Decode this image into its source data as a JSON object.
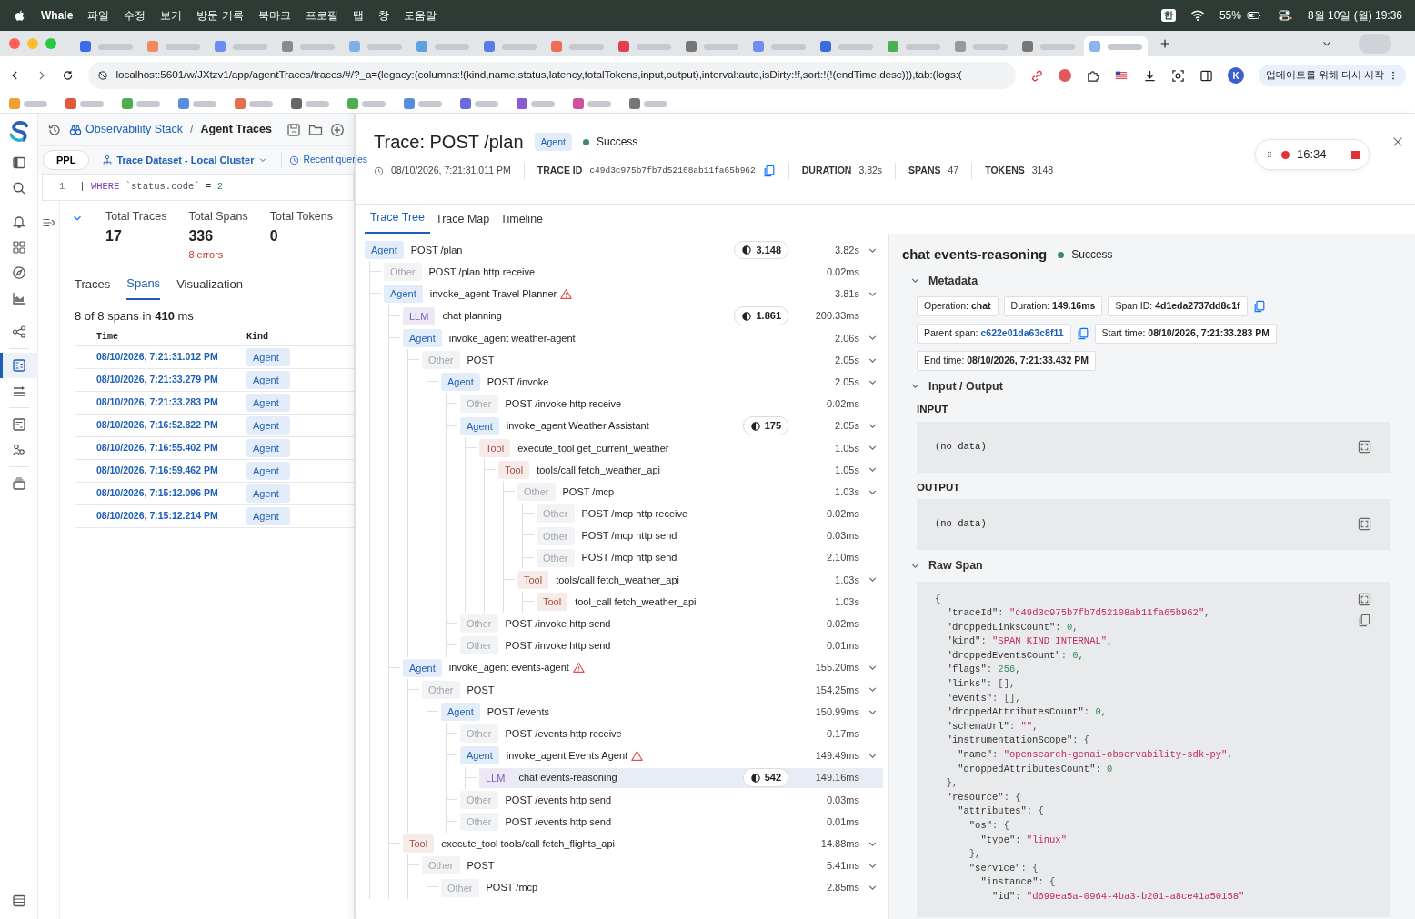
{
  "menubar": {
    "app": "Whale",
    "menus": [
      "파일",
      "수정",
      "보기",
      "방문 기록",
      "북마크",
      "프로필",
      "탭",
      "창",
      "도움말"
    ],
    "input_source": "한",
    "battery": "55%",
    "clock": "8월 10일 (월) 19:36"
  },
  "browser": {
    "tabs": [
      {
        "selected": false,
        "color": "#3a6ee8"
      },
      {
        "selected": false,
        "color": "#f08a5d"
      },
      {
        "selected": false,
        "color": "#6b8cf0"
      },
      {
        "selected": false,
        "color": "#8a8a8a"
      },
      {
        "selected": false,
        "color": "#7fb0e8"
      },
      {
        "selected": false,
        "color": "#5ea0e0"
      },
      {
        "selected": false,
        "color": "#5b7be8"
      },
      {
        "selected": false,
        "color": "#ef6c57"
      },
      {
        "selected": false,
        "color": "#e04050"
      },
      {
        "selected": false,
        "color": "#777777"
      },
      {
        "selected": false,
        "color": "#6f8ff0"
      },
      {
        "selected": false,
        "color": "#3d6ae0"
      },
      {
        "selected": false,
        "color": "#4caf50"
      },
      {
        "selected": false,
        "color": "#999999"
      },
      {
        "selected": false,
        "color": "#777777"
      },
      {
        "selected": true,
        "color": "#8cb4f0"
      }
    ],
    "url": "localhost:5601/w/JXtzv1/app/agentTraces/traces/#/?_a=(legacy:(columns:!(kind,name,status,latency,totalTokens,input,output),interval:auto,isDirty:!f,sort:!(!(endTime,desc))),tab:(logs:(",
    "profile": "K",
    "update_button": "업데이트를 위해 다시 시작",
    "bookmarks": [
      {
        "color": "#f0a030"
      },
      {
        "color": "#e05a3a"
      },
      {
        "color": "#4caf50"
      },
      {
        "color": "#5a8de0"
      },
      {
        "color": "#e07050"
      },
      {
        "color": "#666666"
      },
      {
        "color": "#4caf50"
      },
      {
        "color": "#5a8de0"
      },
      {
        "color": "#6a6ae0"
      },
      {
        "color": "#8a5ad0"
      },
      {
        "color": "#d050a0"
      },
      {
        "color": "#777777"
      }
    ]
  },
  "nav_rail": [
    {
      "selected": false
    },
    {
      "selected": false
    },
    {
      "selected": false
    },
    {
      "selected": false
    },
    {
      "selected": false
    },
    {
      "selected": false
    },
    {
      "selected": false
    },
    {
      "selected": true
    },
    {
      "selected": false
    },
    {
      "selected": false
    },
    {
      "selected": false
    },
    {
      "selected": false
    },
    {
      "selected": false
    }
  ],
  "breadcrumb": {
    "parent": "Observability Stack",
    "separator": "/",
    "current": "Agent Traces"
  },
  "query": {
    "language": "PPL",
    "dataset": "Trace Dataset - Local Cluster",
    "recent": "Recent queries",
    "line_number": "1",
    "tokens": [
      {
        "kind": "pipe",
        "text": "|"
      },
      {
        "kind": "keyword",
        "text": "WHERE"
      },
      {
        "kind": "field",
        "text": "`status.code`"
      },
      {
        "kind": "operator",
        "text": "="
      },
      {
        "kind": "number",
        "text": "2"
      }
    ]
  },
  "summary": {
    "expanded": true,
    "stats": [
      {
        "label": "Total Traces",
        "value": "17"
      },
      {
        "label": "Total Spans",
        "value": "336",
        "note": "8 errors"
      },
      {
        "label": "Total Tokens",
        "value": "0"
      }
    ]
  },
  "result_tabs": [
    {
      "label": "Traces",
      "selected": false
    },
    {
      "label": "Spans",
      "selected": true
    },
    {
      "label": "Visualization",
      "selected": false
    }
  ],
  "result_count": "8 of 8 spans in **410** ms",
  "spans_table": {
    "columns": [
      "Time",
      "Kind"
    ],
    "rows": [
      {
        "time": "08/10/2026, 7:21:31.012 PM",
        "kind": "Agent"
      },
      {
        "time": "08/10/2026, 7:21:33.279 PM",
        "kind": "Agent"
      },
      {
        "time": "08/10/2026, 7:21:33.283 PM",
        "kind": "Agent"
      },
      {
        "time": "08/10/2026, 7:16:52.822 PM",
        "kind": "Agent"
      },
      {
        "time": "08/10/2026, 7:16:55.402 PM",
        "kind": "Agent"
      },
      {
        "time": "08/10/2026, 7:16:59.462 PM",
        "kind": "Agent"
      },
      {
        "time": "08/10/2026, 7:15:12.096 PM",
        "kind": "Agent"
      },
      {
        "time": "08/10/2026, 7:15:12.214 PM",
        "kind": "Agent"
      }
    ]
  },
  "trace": {
    "title": "Trace: POST /plan",
    "kind": "Agent",
    "status": {
      "label": "Success",
      "color": "#3d8a64"
    },
    "timestamp": "08/10/2026, 7:21:31.011 PM",
    "stats": [
      {
        "label": "TRACE ID",
        "value": "c49d3c975b7fb7d52108ab11fa65b962",
        "kind": "id"
      },
      {
        "label": "DURATION",
        "value": "3.82s",
        "kind": "plain"
      },
      {
        "label": "SPANS",
        "value": "47",
        "kind": "plain"
      },
      {
        "label": "TOKENS",
        "value": "3148",
        "kind": "plain"
      }
    ]
  },
  "recorder": {
    "time": "16:34",
    "recording": true
  },
  "trace_tabs": [
    {
      "label": "Trace Tree",
      "selected": true
    },
    {
      "label": "Trace Map",
      "selected": false
    },
    {
      "label": "Timeline",
      "selected": false
    }
  ],
  "trace_tree": [
    {
      "kind": "Agent",
      "name": "POST /plan",
      "tokens": "3.148",
      "duration": "3.82s",
      "warning": false,
      "expanded": true,
      "selected": false,
      "children": [
        {
          "kind": "Other",
          "name": "POST /plan http receive",
          "duration": "0.02ms",
          "warning": false,
          "selected": false
        },
        {
          "kind": "Agent",
          "name": "invoke_agent Travel Planner",
          "duration": "3.81s",
          "warning": true,
          "expanded": true,
          "selected": false,
          "children": [
            {
              "kind": "LLM",
              "name": "chat planning",
              "tokens": "1.861",
              "duration": "200.33ms",
              "warning": false,
              "selected": false
            },
            {
              "kind": "Agent",
              "name": "invoke_agent weather-agent",
              "duration": "2.06s",
              "warning": false,
              "expanded": true,
              "selected": false,
              "children": [
                {
                  "kind": "Other",
                  "name": "POST",
                  "duration": "2.05s",
                  "warning": false,
                  "expanded": true,
                  "selected": false,
                  "children": [
                    {
                      "kind": "Agent",
                      "name": "POST /invoke",
                      "duration": "2.05s",
                      "warning": false,
                      "expanded": true,
                      "selected": false,
                      "children": [
                        {
                          "kind": "Other",
                          "name": "POST /invoke http receive",
                          "duration": "0.02ms",
                          "warning": false,
                          "selected": false
                        },
                        {
                          "kind": "Agent",
                          "name": "invoke_agent Weather Assistant",
                          "tokens": "175",
                          "duration": "2.05s",
                          "warning": false,
                          "expanded": true,
                          "selected": false,
                          "children": [
                            {
                              "kind": "Tool",
                              "name": "execute_tool get_current_weather",
                              "duration": "1.05s",
                              "warning": false,
                              "expanded": true,
                              "selected": false,
                              "children": [
                                {
                                  "kind": "Tool",
                                  "name": "tools/call fetch_weather_api",
                                  "duration": "1.05s",
                                  "warning": false,
                                  "expanded": true,
                                  "selected": false,
                                  "children": [
                                    {
                                      "kind": "Other",
                                      "name": "POST /mcp",
                                      "duration": "1.03s",
                                      "warning": false,
                                      "expanded": true,
                                      "selected": false,
                                      "children": [
                                        {
                                          "kind": "Other",
                                          "name": "POST /mcp http receive",
                                          "duration": "0.02ms",
                                          "warning": false,
                                          "selected": false
                                        },
                                        {
                                          "kind": "Other",
                                          "name": "POST /mcp http send",
                                          "duration": "0.03ms",
                                          "warning": false,
                                          "selected": false
                                        },
                                        {
                                          "kind": "Other",
                                          "name": "POST /mcp http send",
                                          "duration": "2.10ms",
                                          "warning": false,
                                          "selected": false
                                        }
                                      ]
                                    },
                                    {
                                      "kind": "Tool",
                                      "name": "tools/call fetch_weather_api",
                                      "duration": "1.03s",
                                      "warning": false,
                                      "expanded": true,
                                      "selected": false,
                                      "children": [
                                        {
                                          "kind": "Tool",
                                          "name": "tool_call fetch_weather_api",
                                          "duration": "1.03s",
                                          "warning": false,
                                          "selected": false
                                        }
                                      ]
                                    }
                                  ]
                                }
                              ]
                            }
                          ]
                        },
                        {
                          "kind": "Other",
                          "name": "POST /invoke http send",
                          "duration": "0.02ms",
                          "warning": false,
                          "selected": false
                        },
                        {
                          "kind": "Other",
                          "name": "POST /invoke http send",
                          "duration": "0.01ms",
                          "warning": false,
                          "selected": false
                        }
                      ]
                    }
                  ]
                }
              ]
            },
            {
              "kind": "Agent",
              "name": "invoke_agent events-agent",
              "duration": "155.20ms",
              "warning": true,
              "expanded": true,
              "selected": false,
              "children": [
                {
                  "kind": "Other",
                  "name": "POST",
                  "duration": "154.25ms",
                  "warning": false,
                  "expanded": true,
                  "selected": false,
                  "children": [
                    {
                      "kind": "Agent",
                      "name": "POST /events",
                      "duration": "150.99ms",
                      "warning": false,
                      "expanded": true,
                      "selected": false,
                      "children": [
                        {
                          "kind": "Other",
                          "name": "POST /events http receive",
                          "duration": "0.17ms",
                          "warning": false,
                          "selected": false
                        },
                        {
                          "kind": "Agent",
                          "name": "invoke_agent Events Agent",
                          "duration": "149.49ms",
                          "warning": true,
                          "expanded": true,
                          "selected": false,
                          "children": [
                            {
                              "kind": "LLM",
                              "name": "chat events-reasoning",
                              "tokens": "542",
                              "duration": "149.16ms",
                              "warning": false,
                              "selected": true
                            }
                          ]
                        },
                        {
                          "kind": "Other",
                          "name": "POST /events http send",
                          "duration": "0.03ms",
                          "warning": false,
                          "selected": false
                        },
                        {
                          "kind": "Other",
                          "name": "POST /events http send",
                          "duration": "0.01ms",
                          "warning": false,
                          "selected": false
                        }
                      ]
                    }
                  ]
                }
              ]
            },
            {
              "kind": "Tool",
              "name": "execute_tool tools/call fetch_flights_api",
              "duration": "14.88ms",
              "warning": false,
              "expanded": true,
              "selected": false,
              "children": [
                {
                  "kind": "Other",
                  "name": "POST",
                  "duration": "5.41ms",
                  "warning": false,
                  "expanded": true,
                  "selected": false,
                  "children": [
                    {
                      "kind": "Other",
                      "name": "POST /mcp",
                      "duration": "2.85ms",
                      "warning": false,
                      "expanded": true,
                      "selected": false
                    }
                  ]
                }
              ]
            }
          ]
        }
      ]
    }
  ],
  "detail": {
    "title": "chat events-reasoning",
    "status": {
      "label": "Success",
      "color": "#3d8a64"
    },
    "metadata": {
      "title": "Metadata",
      "expanded": true,
      "chips": [
        {
          "label": "Operation:",
          "value": "chat",
          "link": false,
          "copy": false
        },
        {
          "label": "Duration:",
          "value": "149.16ms",
          "link": false,
          "copy": false
        },
        {
          "label": "Span ID:",
          "value": "4d1eda2737dd8c1f",
          "link": false,
          "copy": true
        },
        {
          "label": "Parent span:",
          "value": "c622e01da63c8f11",
          "link": true,
          "copy": true
        },
        {
          "label": "Start time:",
          "value": "08/10/2026, 7:21:33.283 PM",
          "link": false,
          "copy": false
        },
        {
          "label": "End time:",
          "value": "08/10/2026, 7:21:33.432 PM",
          "link": false,
          "copy": false
        }
      ]
    },
    "io": {
      "title": "Input / Output",
      "expanded": true,
      "blocks": [
        {
          "label": "INPUT",
          "value": "(no data)"
        },
        {
          "label": "OUTPUT",
          "value": "(no data)"
        }
      ]
    },
    "raw": {
      "title": "Raw Span",
      "expanded": true,
      "lines": [
        "{",
        "  \"traceId\": \"c49d3c975b7fb7d52108ab11fa65b962\",",
        "  \"droppedLinksCount\": 0,",
        "  \"kind\": \"SPAN_KIND_INTERNAL\",",
        "  \"droppedEventsCount\": 0,",
        "  \"flags\": 256,",
        "  \"links\": [],",
        "  \"events\": [],",
        "  \"droppedAttributesCount\": 0,",
        "  \"schemaUrl\": \"\",",
        "  \"instrumentationScope\": {",
        "    \"name\": \"opensearch-genai-observability-sdk-py\",",
        "    \"droppedAttributesCount\": 0",
        "  },",
        "  \"resource\": {",
        "    \"attributes\": {",
        "      \"os\": {",
        "        \"type\": \"linux\"",
        "      },",
        "      \"service\": {",
        "        \"instance\": {",
        "          \"id\": \"d699ea5a-0964-4ba3-b201-a8ce41a50158\""
      ]
    }
  }
}
